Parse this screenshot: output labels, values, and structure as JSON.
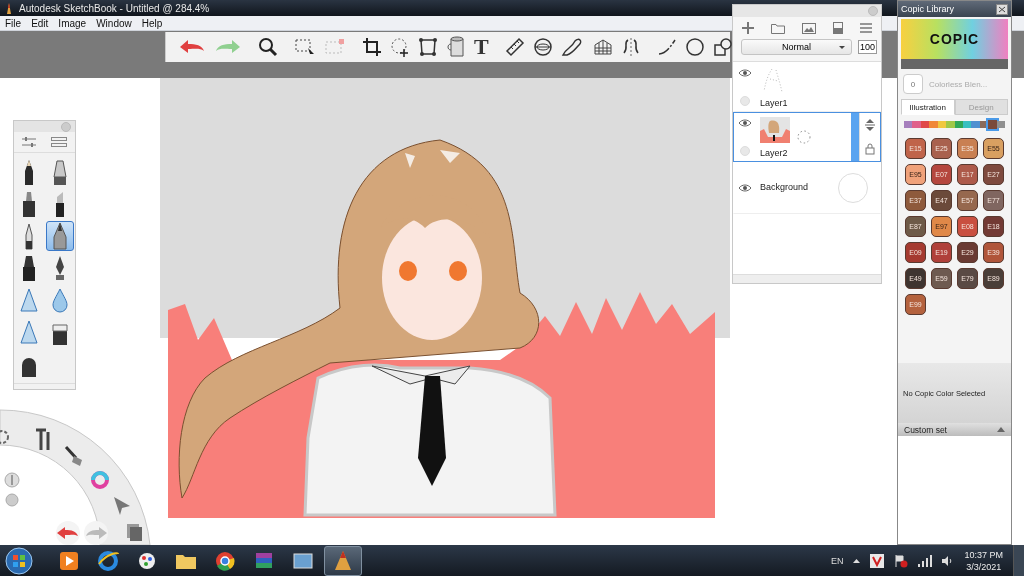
{
  "window": {
    "title": "Autodesk SketchBook - Untitled @ 284.4%"
  },
  "menu": [
    "File",
    "Edit",
    "Image",
    "Window",
    "Help"
  ],
  "toolbar": {
    "text_glyph": "T"
  },
  "brushes": [
    {
      "kind": "pencil",
      "selected": false
    },
    {
      "kind": "airbrush",
      "selected": false
    },
    {
      "kind": "marker",
      "selected": false
    },
    {
      "kind": "chisel",
      "selected": false
    },
    {
      "kind": "ballpoint",
      "selected": false
    },
    {
      "kind": "fineliner",
      "selected": true
    },
    {
      "kind": "felt",
      "selected": false
    },
    {
      "kind": "inkpen",
      "selected": false
    },
    {
      "kind": "cone",
      "selected": false
    },
    {
      "kind": "drop",
      "selected": false
    },
    {
      "kind": "cone",
      "selected": false
    },
    {
      "kind": "eraser",
      "selected": false
    },
    {
      "kind": "eraser_round",
      "selected": false
    }
  ],
  "layers_panel": {
    "blend_mode": "Normal",
    "opacity": "100",
    "layers": [
      {
        "name": "Layer1",
        "kind": "sketch",
        "selected": false
      },
      {
        "name": "Layer2",
        "kind": "paint",
        "selected": true
      },
      {
        "name": "Background",
        "kind": "background",
        "selected": false
      }
    ]
  },
  "copic": {
    "title": "Copic Library",
    "logo": "COPIC",
    "blender_code": "0",
    "blender_name": "Colorless Blen...",
    "tabs": [
      {
        "label": "Illustration",
        "selected": true
      },
      {
        "label": "Design",
        "selected": false
      }
    ],
    "hues": [
      {
        "color": "#a67fbd",
        "selected": false
      },
      {
        "color": "#e0608a",
        "selected": false
      },
      {
        "color": "#e04848",
        "selected": false
      },
      {
        "color": "#f08838",
        "selected": false
      },
      {
        "color": "#f0c840",
        "selected": false
      },
      {
        "color": "#a0c848",
        "selected": false
      },
      {
        "color": "#30a858",
        "selected": false
      },
      {
        "color": "#38c0c0",
        "selected": false
      },
      {
        "color": "#5090d0",
        "selected": false
      },
      {
        "color": "#8a6a5a",
        "selected": false
      },
      {
        "color": "#7a4a3a",
        "selected": true
      },
      {
        "color": "#909090",
        "selected": false
      }
    ],
    "swatches": [
      {
        "code": "E15",
        "color": "#c0644a"
      },
      {
        "code": "E25",
        "color": "#a9614e"
      },
      {
        "code": "E35",
        "color": "#c98052"
      },
      {
        "code": "E55",
        "color": "#d9a061"
      },
      {
        "code": "E95",
        "color": "#f0a27a"
      },
      {
        "code": "E07",
        "color": "#b5473e"
      },
      {
        "code": "E17",
        "color": "#ad5a4a"
      },
      {
        "code": "E27",
        "color": "#7e4a3e"
      },
      {
        "code": "E37",
        "color": "#8e5a3c"
      },
      {
        "code": "E47",
        "color": "#6b4a3a"
      },
      {
        "code": "E57",
        "color": "#96684e"
      },
      {
        "code": "E77",
        "color": "#806660"
      },
      {
        "code": "E87",
        "color": "#6e5a48"
      },
      {
        "code": "E97",
        "color": "#e08848"
      },
      {
        "code": "E08",
        "color": "#c94f40"
      },
      {
        "code": "E18",
        "color": "#733a34"
      },
      {
        "code": "E09",
        "color": "#a53a30"
      },
      {
        "code": "E19",
        "color": "#b0403a"
      },
      {
        "code": "E29",
        "color": "#6a3a32"
      },
      {
        "code": "E39",
        "color": "#b0553a"
      },
      {
        "code": "E49",
        "color": "#3e3430"
      },
      {
        "code": "E59",
        "color": "#6e5a50"
      },
      {
        "code": "E79",
        "color": "#5a4a44"
      },
      {
        "code": "E89",
        "color": "#4a3e38"
      },
      {
        "code": "E99",
        "color": "#b4623e"
      }
    ],
    "status": "No Copic Color Selected",
    "custom_set": "Custom set"
  },
  "taskbar": {
    "apps": [
      {
        "kind": "media",
        "selected": false
      },
      {
        "kind": "browser",
        "selected": false
      },
      {
        "kind": "paint",
        "selected": false
      },
      {
        "kind": "folder",
        "selected": false
      },
      {
        "kind": "chrome",
        "selected": false
      },
      {
        "kind": "archive",
        "selected": false
      },
      {
        "kind": "photo",
        "selected": false
      },
      {
        "kind": "sketch",
        "selected": true
      }
    ],
    "language": "EN",
    "time": "10:37 PM",
    "date": "3/3/2021"
  }
}
